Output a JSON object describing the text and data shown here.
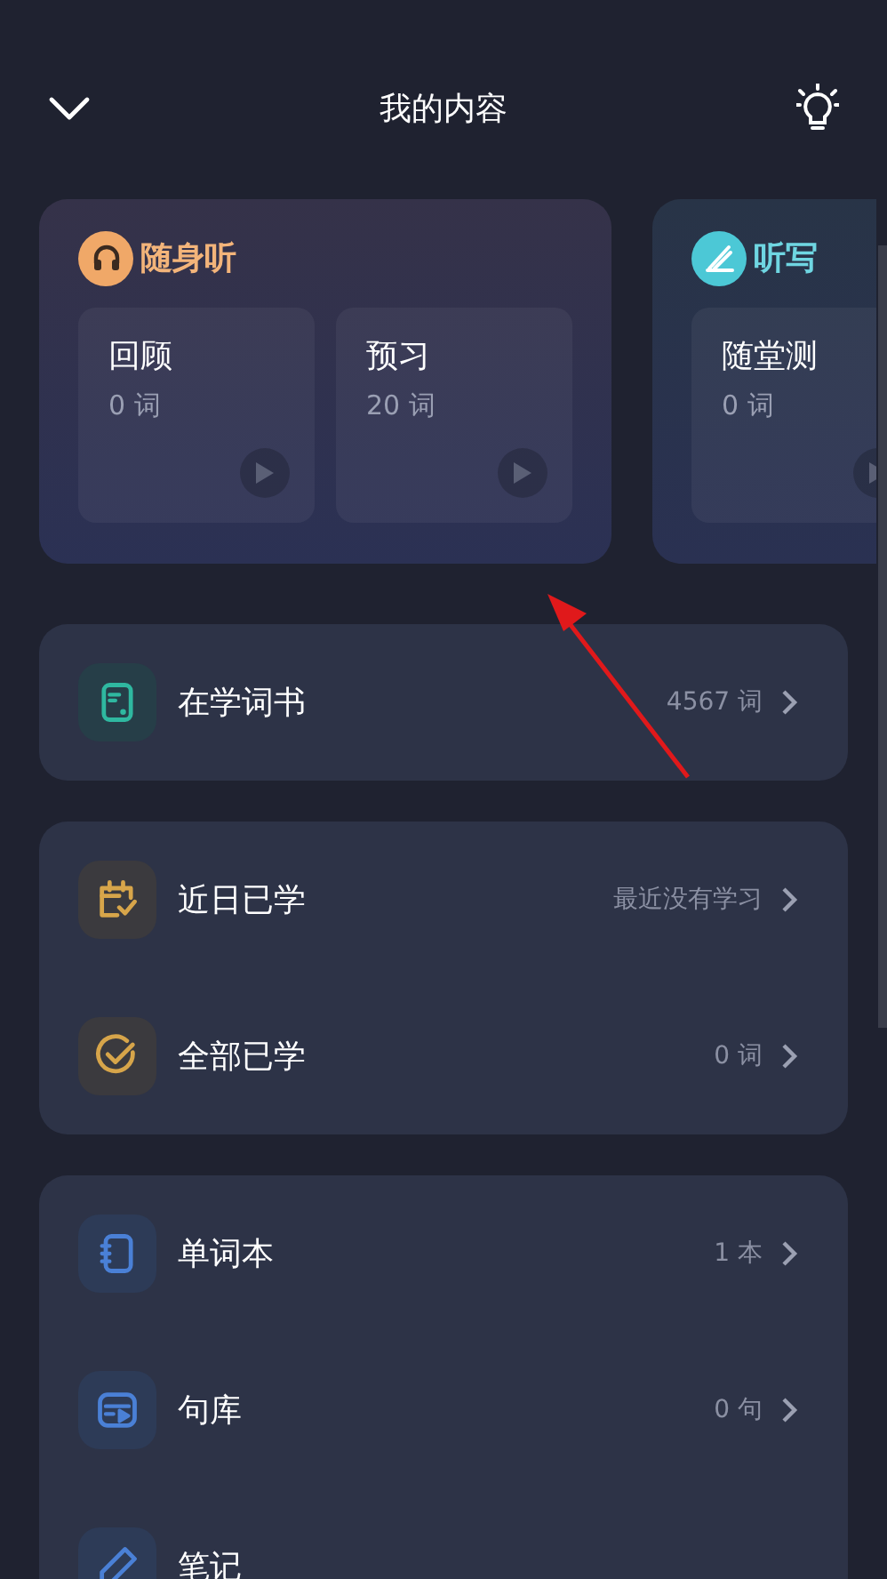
{
  "header": {
    "title": "我的内容"
  },
  "feature_cards": [
    {
      "kind": "listen",
      "title": "随身听",
      "tiles": [
        {
          "title": "回顾",
          "count": "0 词"
        },
        {
          "title": "预习",
          "count": "20 词"
        }
      ]
    },
    {
      "kind": "dictation",
      "title": "听写",
      "tiles": [
        {
          "title": "随堂测",
          "count": "0 词"
        }
      ]
    }
  ],
  "groups": [
    {
      "items": [
        {
          "kind": "book",
          "label": "在学词书",
          "value": "4567 词"
        }
      ]
    },
    {
      "items": [
        {
          "kind": "calendar",
          "label": "近日已学",
          "value": "最近没有学习"
        },
        {
          "kind": "check",
          "label": "全部已学",
          "value": "0 词"
        }
      ]
    },
    {
      "items": [
        {
          "kind": "notebook",
          "label": "单词本",
          "value": "1 本"
        },
        {
          "kind": "sentences",
          "label": "句库",
          "value": "0 句"
        },
        {
          "kind": "pen",
          "label": "笔记"
        }
      ]
    }
  ]
}
